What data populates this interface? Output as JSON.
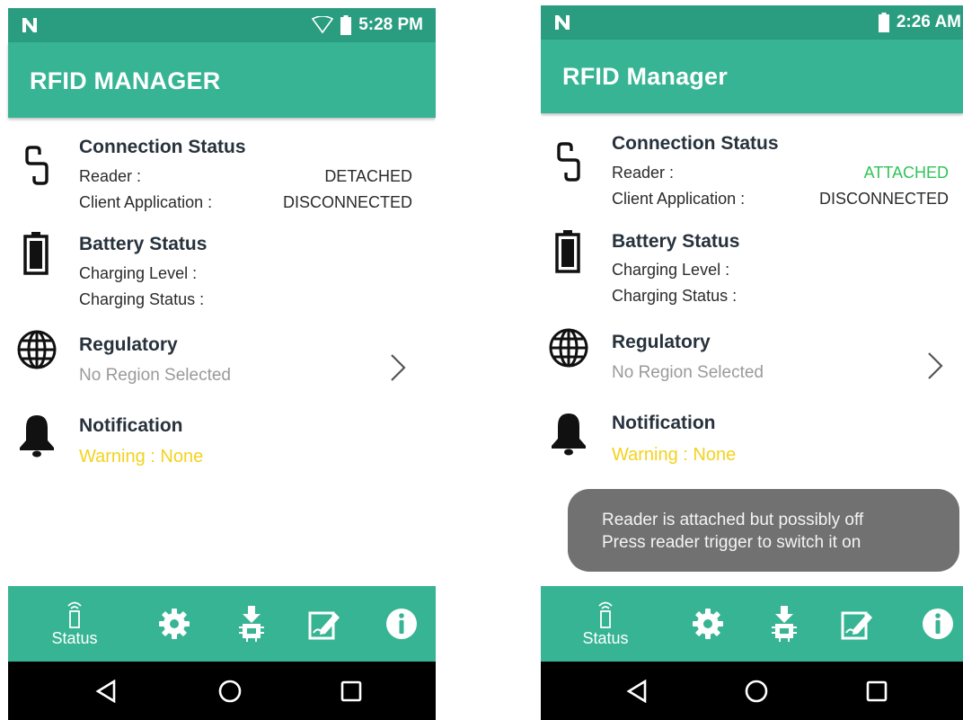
{
  "screens": [
    {
      "status_bar": {
        "time": "5:28 PM"
      },
      "app_title": "RFID MANAGER",
      "connection": {
        "heading": "Connection Status",
        "reader_label": "Reader :",
        "reader_value": "DETACHED",
        "client_label": "Client Application :",
        "client_value": "DISCONNECTED"
      },
      "battery": {
        "heading": "Battery Status",
        "level_label": "Charging Level :",
        "status_label": "Charging Status :"
      },
      "regulatory": {
        "heading": "Regulatory",
        "value": "No Region Selected"
      },
      "notification": {
        "heading": "Notification",
        "value": "Warning : None"
      },
      "bottom_tab_label": "Status"
    },
    {
      "status_bar": {
        "time": "2:26 AM"
      },
      "app_title": "RFID Manager",
      "connection": {
        "heading": "Connection Status",
        "reader_label": "Reader :",
        "reader_value": "ATTACHED",
        "client_label": "Client Application :",
        "client_value": "DISCONNECTED"
      },
      "battery": {
        "heading": "Battery Status",
        "level_label": "Charging Level :",
        "status_label": "Charging Status :"
      },
      "regulatory": {
        "heading": "Regulatory",
        "value": "No Region Selected"
      },
      "notification": {
        "heading": "Notification",
        "value": "Warning : None"
      },
      "toast": {
        "line1": "Reader is attached but possibly off",
        "line2": "Press reader trigger to switch it on"
      },
      "bottom_tab_label": "Status"
    }
  ],
  "icons": {
    "status_bar": [
      "n-logo-icon",
      "wifi-icon",
      "battery-status-icon"
    ],
    "sections": [
      "link-icon",
      "battery-icon",
      "globe-icon",
      "bell-icon"
    ],
    "bottom_bar": [
      "rfid-reader-icon",
      "gear-icon",
      "firmware-download-icon",
      "edit-icon",
      "info-icon"
    ],
    "nav_bar": [
      "back-icon",
      "home-icon",
      "recents-icon"
    ]
  },
  "colors": {
    "status_bar": "#2a9d81",
    "app_bar": "#36b493",
    "attached_green": "#31c35a",
    "warning_yellow": "#f4d21f",
    "toast_bg": "#717171"
  }
}
